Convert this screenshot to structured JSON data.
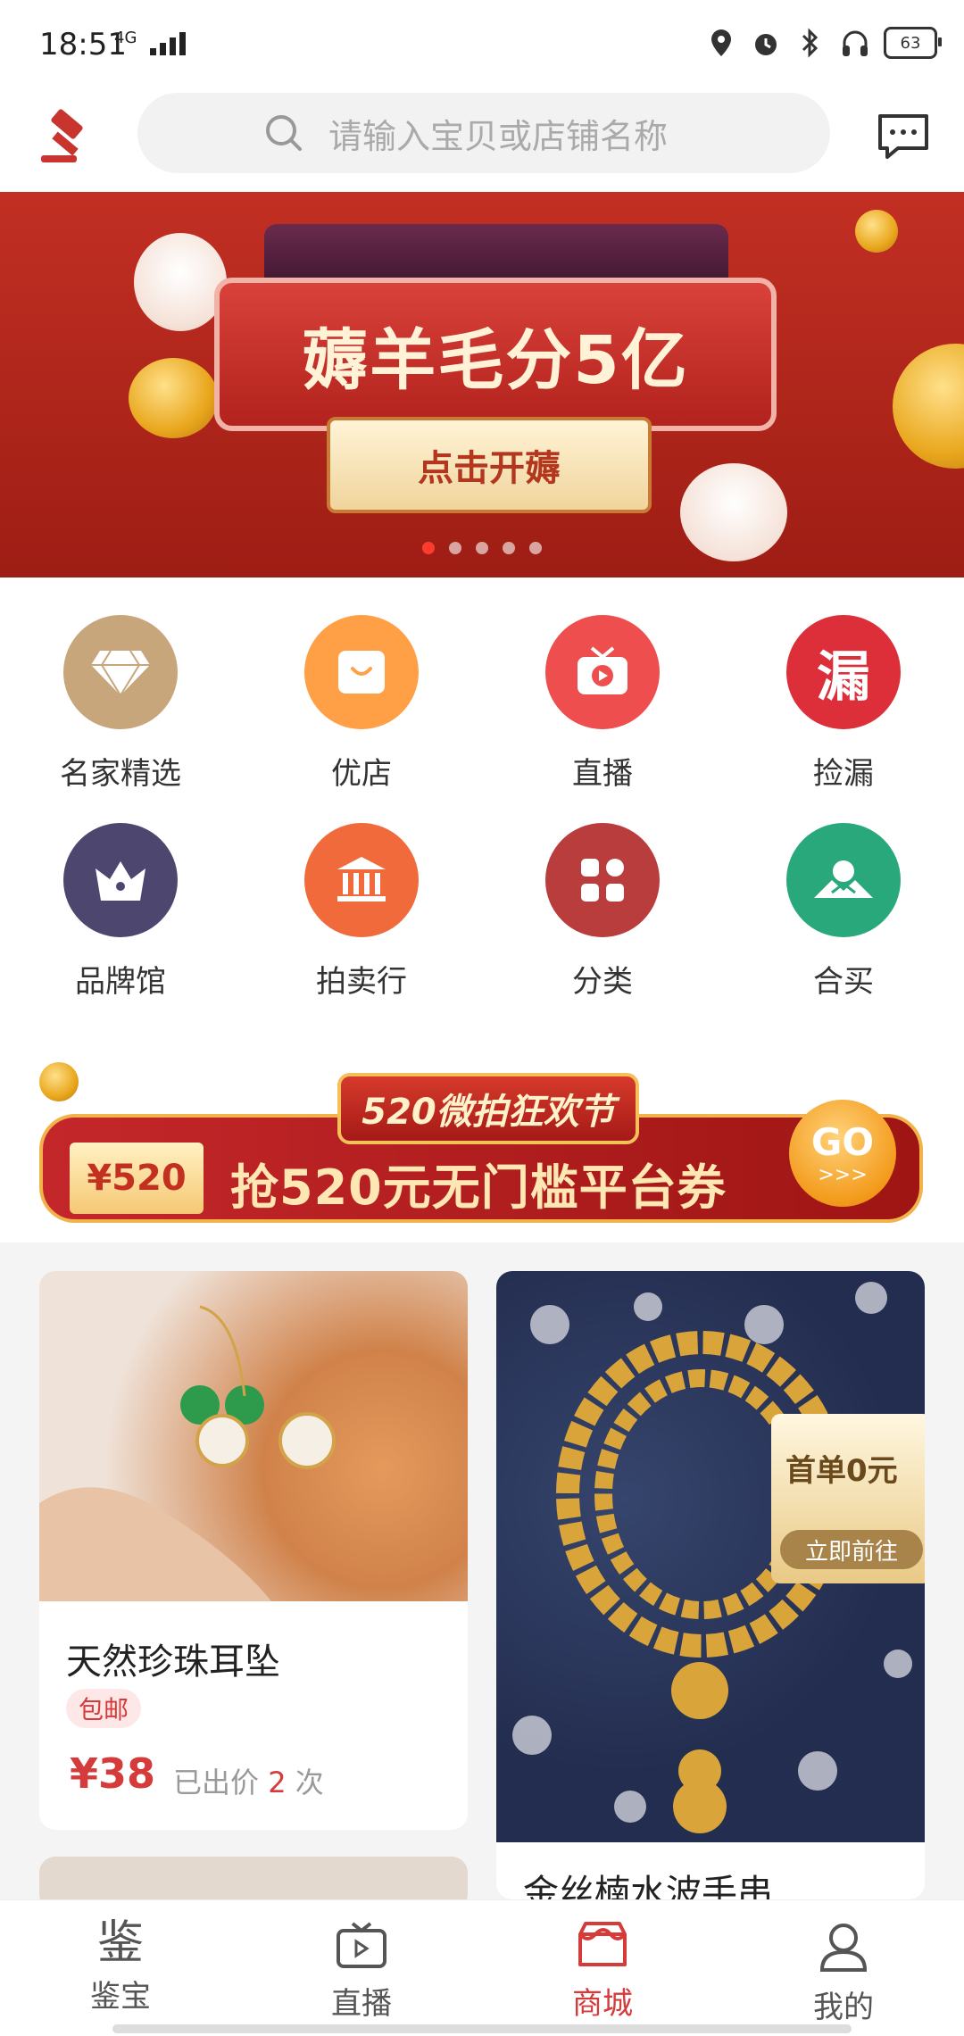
{
  "status": {
    "time": "18:51",
    "network": "4G",
    "battery": "63"
  },
  "header": {
    "search_placeholder": "请输入宝贝或店铺名称"
  },
  "banner": {
    "headline": "薅羊毛分5亿",
    "cta": "点击开薅",
    "slides": [
      1,
      2,
      3,
      4,
      5
    ],
    "active_index": 0
  },
  "menu": {
    "items": [
      {
        "label": "名家精选",
        "icon": "diamond-icon",
        "color": "#c8a67b"
      },
      {
        "label": "优店",
        "icon": "shop-icon",
        "color": "#ffa046"
      },
      {
        "label": "直播",
        "icon": "tv-play-icon",
        "color": "#ef4e4e"
      },
      {
        "label": "捡漏",
        "icon": "lou-char-icon",
        "color": "#dc2f3a"
      },
      {
        "label": "品牌馆",
        "icon": "crown-icon",
        "color": "#4d4770"
      },
      {
        "label": "拍卖行",
        "icon": "building-icon",
        "color": "#f06a3c"
      },
      {
        "label": "分类",
        "icon": "grid-icon",
        "color": "#ba3d3d"
      },
      {
        "label": "合买",
        "icon": "mountain-icon",
        "color": "#29a97b"
      }
    ]
  },
  "promo": {
    "top_title": "520微拍狂欢节",
    "tag": "¥520",
    "main": "抢520元无门槛平台券",
    "go": "GO",
    "arrows": ">>>"
  },
  "products": [
    {
      "title": "天然珍珠耳坠",
      "badge": "包邮",
      "price": "¥38",
      "bid_prefix": "已出价",
      "bid_count": "2",
      "bid_suffix": "次"
    },
    {
      "title": "金丝楠水波手串",
      "promo_badge": "首单0元",
      "promo_cta": "立即前往"
    }
  ],
  "tabbar": {
    "tabs": [
      {
        "label": "鉴宝",
        "icon": "appraisal-icon"
      },
      {
        "label": "直播",
        "icon": "live-icon"
      },
      {
        "label": "商城",
        "icon": "store-icon",
        "active": true
      },
      {
        "label": "我的",
        "icon": "user-icon"
      }
    ]
  }
}
